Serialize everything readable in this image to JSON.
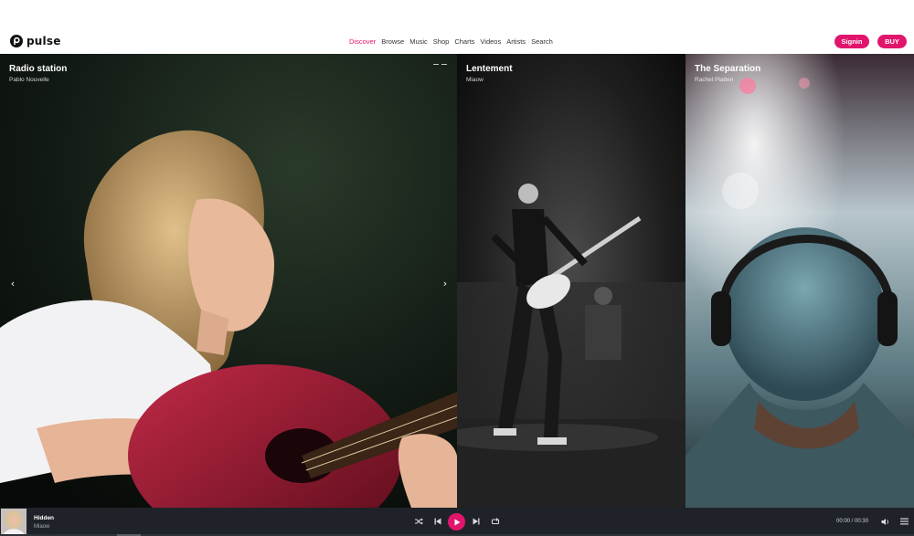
{
  "brand": {
    "name": "pulse",
    "logo_icon": "pulse-logo-icon"
  },
  "nav": [
    {
      "label": "Discover",
      "active": true
    },
    {
      "label": "Browse",
      "active": false
    },
    {
      "label": "Music",
      "active": false
    },
    {
      "label": "Shop",
      "active": false
    },
    {
      "label": "Charts",
      "active": false
    },
    {
      "label": "Videos",
      "active": false
    },
    {
      "label": "Artists",
      "active": false
    },
    {
      "label": "Search",
      "active": false
    }
  ],
  "actions": {
    "signin_label": "Signin",
    "buy_label": "BUY"
  },
  "slides": [
    {
      "title": "Radio station",
      "artist": "Pablo Nouvelle"
    },
    {
      "title": "Lentement",
      "artist": "Miaow"
    },
    {
      "title": "The Separation",
      "artist": "Rachel Platten"
    }
  ],
  "carousel": {
    "prev_icon": "chevron-left-icon",
    "next_icon": "chevron-right-icon",
    "prev_glyph": "‹",
    "next_glyph": "›"
  },
  "player": {
    "track_title": "Hidden",
    "track_artist": "Miaow",
    "time": "00:00 / 00:30",
    "progress": 0,
    "controls": [
      "shuffle-icon",
      "previous-icon",
      "play-icon",
      "next-icon",
      "repeat-icon",
      "volume-icon",
      "playlist-menu-icon"
    ]
  },
  "colors": {
    "accent": "#e2156c",
    "player_bg": "#1f2329",
    "text_dark": "#222222"
  }
}
